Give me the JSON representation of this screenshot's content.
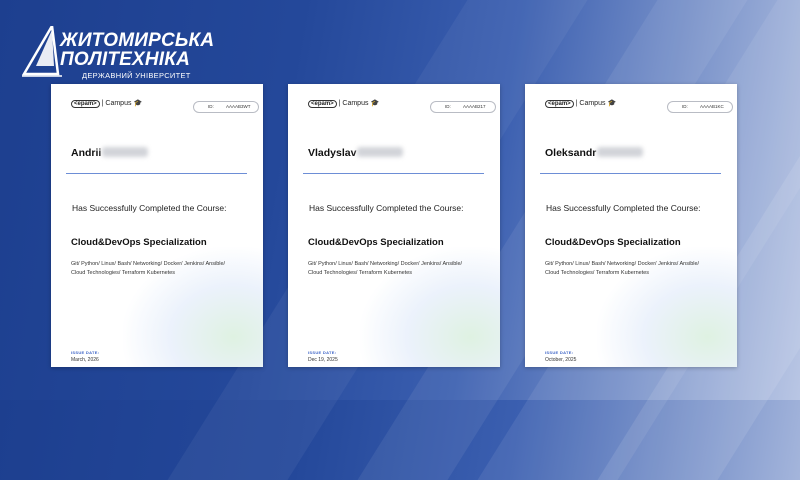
{
  "logo": {
    "line1": "ЖИТОМИРСЬКА",
    "line2": "ПОЛІТЕХНІКА",
    "subtitle": "ДЕРЖАВНИЙ УНІВЕРСИТЕТ"
  },
  "certificates": [
    {
      "brand": "<epam>",
      "campus": "Campus",
      "id_label": "ID:",
      "id_value": "AAAAB3WT",
      "first_name": "Andrii",
      "completed_text": "Has Successfully Completed the Course:",
      "course": "Cloud&DevOps Specialization",
      "skills": "Git/ Python/ Linux/ Bash/ Networking/ Docker/ Jenkins/ Ansible/ Cloud Technologies/ Terraform Kubernetes",
      "issue_label": "ISSUE DATE:",
      "issue_date": "March, 2026"
    },
    {
      "brand": "<epam>",
      "campus": "Campus",
      "id_label": "ID:",
      "id_value": "AAAAB217",
      "first_name": "Vladyslav",
      "completed_text": "Has Successfully Completed the Course:",
      "course": "Cloud&DevOps Specialization",
      "skills": "Git/ Python/ Linux/ Bash/ Networking/ Docker/ Jenkins/ Ansible/ Cloud Technologies/ Terraform Kubernetes",
      "issue_label": "ISSUE DATE:",
      "issue_date": "Dec 19, 2025"
    },
    {
      "brand": "<epam>",
      "campus": "Campus",
      "id_label": "ID:",
      "id_value": "AAAAB1KC",
      "first_name": "Oleksandr",
      "completed_text": "Has Successfully Completed the Course:",
      "course": "Cloud&DevOps Specialization",
      "skills": "Git/ Python/ Linux/ Bash/ Networking/ Docker/ Jenkins/ Ansible/ Cloud Technologies/ Terraform Kubernetes",
      "issue_label": "ISSUE DATE:",
      "issue_date": "October, 2025"
    }
  ]
}
